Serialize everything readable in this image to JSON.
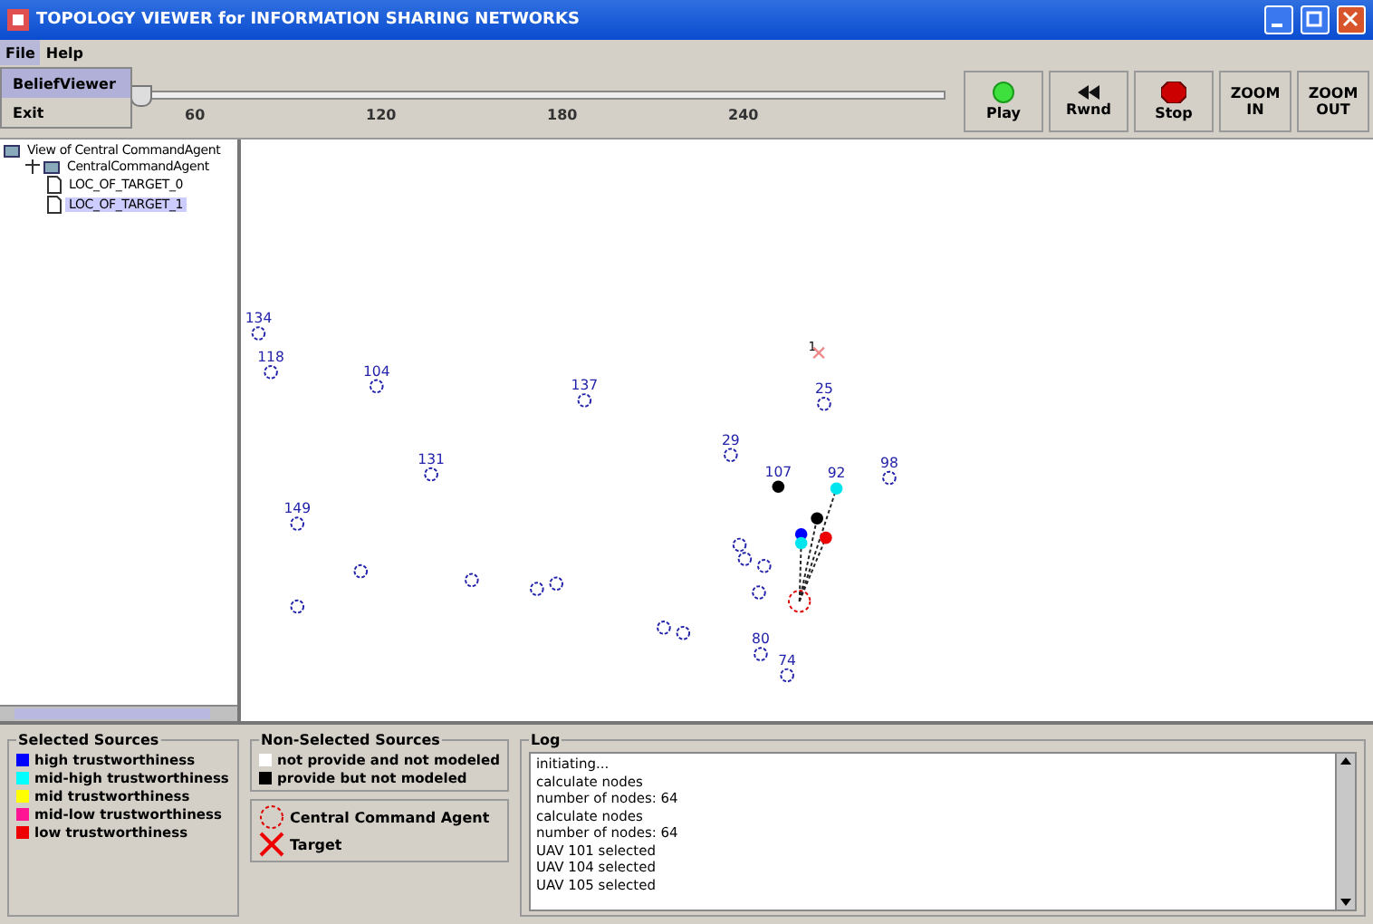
{
  "window": {
    "title": "TOPOLOGY VIEWER for INFORMATION SHARING NETWORKS"
  },
  "menu": [
    {
      "label": "File",
      "selected": true
    },
    {
      "label": "Help",
      "selected": false
    }
  ],
  "file_menu": [
    {
      "label": "BeliefViewer",
      "selected": true
    },
    {
      "label": "Exit",
      "selected": false
    }
  ],
  "timeline": {
    "level": 0.0,
    "ticks": [
      "60",
      "120",
      "180",
      "240"
    ]
  },
  "buttons": [
    {
      "label": "Play"
    },
    {
      "label": "Rwnd"
    },
    {
      "label": "Stop"
    },
    {
      "label": "ZOOM IN"
    },
    {
      "label": "ZOOM OUT"
    }
  ],
  "tree": [
    {
      "label": "View of Central CommandAgent",
      "children": [
        {
          "label": "CentralCommandAgent",
          "expanded": true,
          "children": [
            {
              "label": "LOC_OF_TARGET_0",
              "selected": false
            },
            {
              "label": "LOC_OF_TARGET_1",
              "selected": true
            }
          ]
        }
      ]
    }
  ],
  "nodes": [
    {
      "kind": "plain",
      "label": "134"
    },
    {
      "kind": "plain",
      "label": "118"
    },
    {
      "kind": "plain",
      "label": "104"
    },
    {
      "kind": "plain",
      "label": "137"
    },
    {
      "kind": "plain",
      "label": "131"
    },
    {
      "kind": "plain",
      "label": "149"
    },
    {
      "kind": "plain"
    },
    {
      "kind": "plain"
    },
    {
      "kind": "plain"
    },
    {
      "kind": "plain"
    },
    {
      "kind": "plain"
    },
    {
      "kind": "plain"
    },
    {
      "kind": "plain"
    },
    {
      "kind": "plain"
    },
    {
      "kind": "plain"
    },
    {
      "kind": "plain"
    },
    {
      "kind": "plain"
    },
    {
      "kind": "plain",
      "label": "29"
    },
    {
      "kind": "plain",
      "label": "25"
    },
    {
      "kind": "target",
      "label": "1"
    },
    {
      "kind": "source",
      "label": "107",
      "color": "#000000"
    },
    {
      "kind": "source",
      "label": "92",
      "color": "#00e5ee",
      "linked": true
    },
    {
      "kind": "plain",
      "label": "98"
    },
    {
      "kind": "source",
      "color": "#000000",
      "linked": true
    },
    {
      "kind": "source",
      "color": "#0000ff"
    },
    {
      "kind": "source",
      "color": "#00e5ee",
      "linked": true
    },
    {
      "kind": "source",
      "color": "#ee0000",
      "linked": true
    },
    {
      "kind": "agent"
    },
    {
      "kind": "plain",
      "label": "80"
    },
    {
      "kind": "plain",
      "label": "74"
    }
  ],
  "selected_sources": {
    "title": "Selected Sources",
    "items": [
      {
        "label": "high trustworthiness",
        "color": "#0000ff"
      },
      {
        "label": "mid-high trustworthiness",
        "color": "#00ffff"
      },
      {
        "label": "mid trustworthiness",
        "color": "#ffff00"
      },
      {
        "label": "mid-low trustworthiness",
        "color": "#ff1493"
      },
      {
        "label": "low trustworthiness",
        "color": "#ee0000"
      }
    ]
  },
  "non_selected_sources": {
    "title": "Non-Selected Sources",
    "items": [
      {
        "label": "not provide and not modeled",
        "color": "#ffffff"
      },
      {
        "label": "provide but not modeled",
        "color": "#000000"
      }
    ]
  },
  "symbols": [
    {
      "kind": "agent",
      "label": "Central Command Agent"
    },
    {
      "kind": "target",
      "label": "Target"
    }
  ],
  "log": {
    "title": "Log",
    "lines": [
      "initiating...",
      "calculate nodes",
      "number of nodes: 64",
      "calculate nodes",
      "number of nodes: 64",
      "UAV 101 selected",
      "UAV 104 selected",
      "UAV 105 selected"
    ]
  }
}
